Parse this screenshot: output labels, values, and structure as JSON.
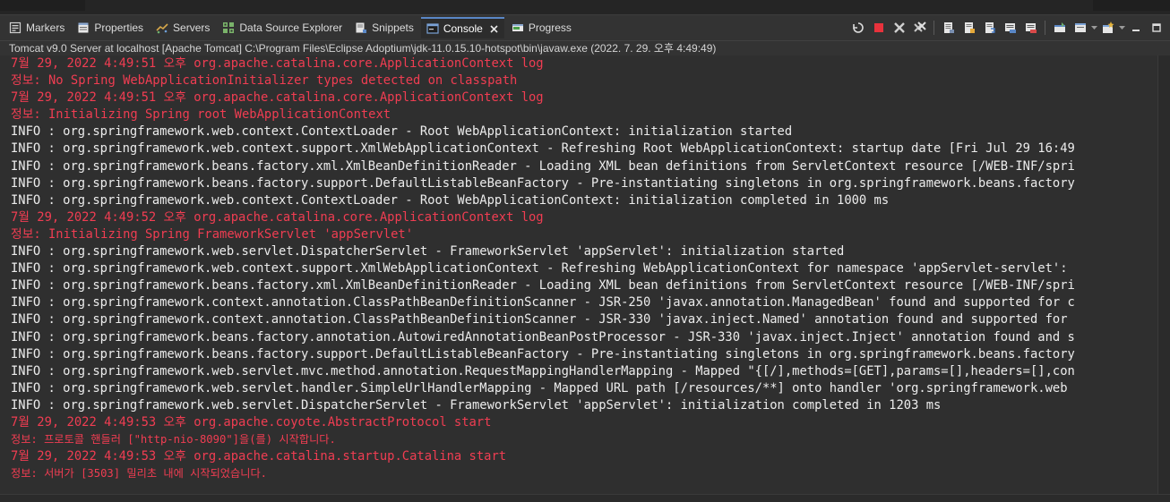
{
  "tabs": [
    {
      "label": "Markers",
      "icon": "markers-icon"
    },
    {
      "label": "Properties",
      "icon": "properties-icon"
    },
    {
      "label": "Servers",
      "icon": "servers-icon"
    },
    {
      "label": "Data Source Explorer",
      "icon": "data-source-explorer-icon"
    },
    {
      "label": "Snippets",
      "icon": "snippets-icon"
    },
    {
      "label": "Console",
      "icon": "console-icon",
      "active": true
    },
    {
      "label": "Progress",
      "icon": "progress-icon"
    }
  ],
  "console": {
    "title": "Tomcat v9.0 Server at localhost [Apache Tomcat] C:\\Program Files\\Eclipse Adoptium\\jdk-11.0.15.10-hotspot\\bin\\javaw.exe  (2022. 7. 29. 오후 4:49:49)",
    "lines": [
      {
        "type": "err",
        "text": "7월 29, 2022 4:49:51 오후 org.apache.catalina.core.ApplicationContext log"
      },
      {
        "type": "err",
        "text": "정보: No Spring WebApplicationInitializer types detected on classpath"
      },
      {
        "type": "err",
        "text": "7월 29, 2022 4:49:51 오후 org.apache.catalina.core.ApplicationContext log"
      },
      {
        "type": "err",
        "text": "정보: Initializing Spring root WebApplicationContext"
      },
      {
        "type": "info",
        "text": "INFO : org.springframework.web.context.ContextLoader - Root WebApplicationContext: initialization started"
      },
      {
        "type": "info",
        "text": "INFO : org.springframework.web.context.support.XmlWebApplicationContext - Refreshing Root WebApplicationContext: startup date [Fri Jul 29 16:49"
      },
      {
        "type": "info",
        "text": "INFO : org.springframework.beans.factory.xml.XmlBeanDefinitionReader - Loading XML bean definitions from ServletContext resource [/WEB-INF/spri"
      },
      {
        "type": "info",
        "text": "INFO : org.springframework.beans.factory.support.DefaultListableBeanFactory - Pre-instantiating singletons in org.springframework.beans.factory"
      },
      {
        "type": "info",
        "text": "INFO : org.springframework.web.context.ContextLoader - Root WebApplicationContext: initialization completed in 1000 ms"
      },
      {
        "type": "err",
        "text": "7월 29, 2022 4:49:52 오후 org.apache.catalina.core.ApplicationContext log"
      },
      {
        "type": "err",
        "text": "정보: Initializing Spring FrameworkServlet 'appServlet'"
      },
      {
        "type": "info",
        "text": "INFO : org.springframework.web.servlet.DispatcherServlet - FrameworkServlet 'appServlet': initialization started"
      },
      {
        "type": "info",
        "text": "INFO : org.springframework.web.context.support.XmlWebApplicationContext - Refreshing WebApplicationContext for namespace 'appServlet-servlet': "
      },
      {
        "type": "info",
        "text": "INFO : org.springframework.beans.factory.xml.XmlBeanDefinitionReader - Loading XML bean definitions from ServletContext resource [/WEB-INF/spri"
      },
      {
        "type": "info",
        "text": "INFO : org.springframework.context.annotation.ClassPathBeanDefinitionScanner - JSR-250 'javax.annotation.ManagedBean' found and supported for c"
      },
      {
        "type": "info",
        "text": "INFO : org.springframework.context.annotation.ClassPathBeanDefinitionScanner - JSR-330 'javax.inject.Named' annotation found and supported for"
      },
      {
        "type": "info",
        "text": "INFO : org.springframework.beans.factory.annotation.AutowiredAnnotationBeanPostProcessor - JSR-330 'javax.inject.Inject' annotation found and s"
      },
      {
        "type": "info",
        "text": "INFO : org.springframework.beans.factory.support.DefaultListableBeanFactory - Pre-instantiating singletons in org.springframework.beans.factory"
      },
      {
        "type": "info",
        "text": "INFO : org.springframework.web.servlet.mvc.method.annotation.RequestMappingHandlerMapping - Mapped \"{[/],methods=[GET],params=[],headers=[],con"
      },
      {
        "type": "info",
        "text": "INFO : org.springframework.web.servlet.handler.SimpleUrlHandlerMapping - Mapped URL path [/resources/**] onto handler 'org.springframework.web"
      },
      {
        "type": "info",
        "text": "INFO : org.springframework.web.servlet.DispatcherServlet - FrameworkServlet 'appServlet': initialization completed in 1203 ms"
      },
      {
        "type": "err",
        "text": "7월 29, 2022 4:49:53 오후 org.apache.coyote.AbstractProtocol start"
      },
      {
        "type": "errsmall",
        "text": "정보: 프로토콜 핸들러 [\"http-nio-8090\"]을(를) 시작합니다."
      },
      {
        "type": "err",
        "text": "7월 29, 2022 4:49:53 오후 org.apache.catalina.startup.Catalina start"
      },
      {
        "type": "errsmall",
        "text": "정보: 서버가 [3503] 밀리초 내에 시작되었습니다."
      }
    ]
  },
  "colors": {
    "background": "#2f2f2f",
    "info_text": "#ececec",
    "error_text": "#f03d52",
    "active_tab_accent": "#5a87c6",
    "terminate_red": "#e8323c"
  },
  "toolbar_icons": [
    "reset-icon",
    "terminate-icon",
    "remove-launch-icon",
    "remove-all-terminated-icon",
    "clear-console-icon",
    "scroll-lock-icon",
    "word-wrap-icon",
    "show-on-stdout-icon",
    "show-on-stderr-icon",
    "pin-console-icon",
    "display-selected-console-icon",
    "open-console-icon",
    "minimize-icon",
    "maximize-icon"
  ]
}
